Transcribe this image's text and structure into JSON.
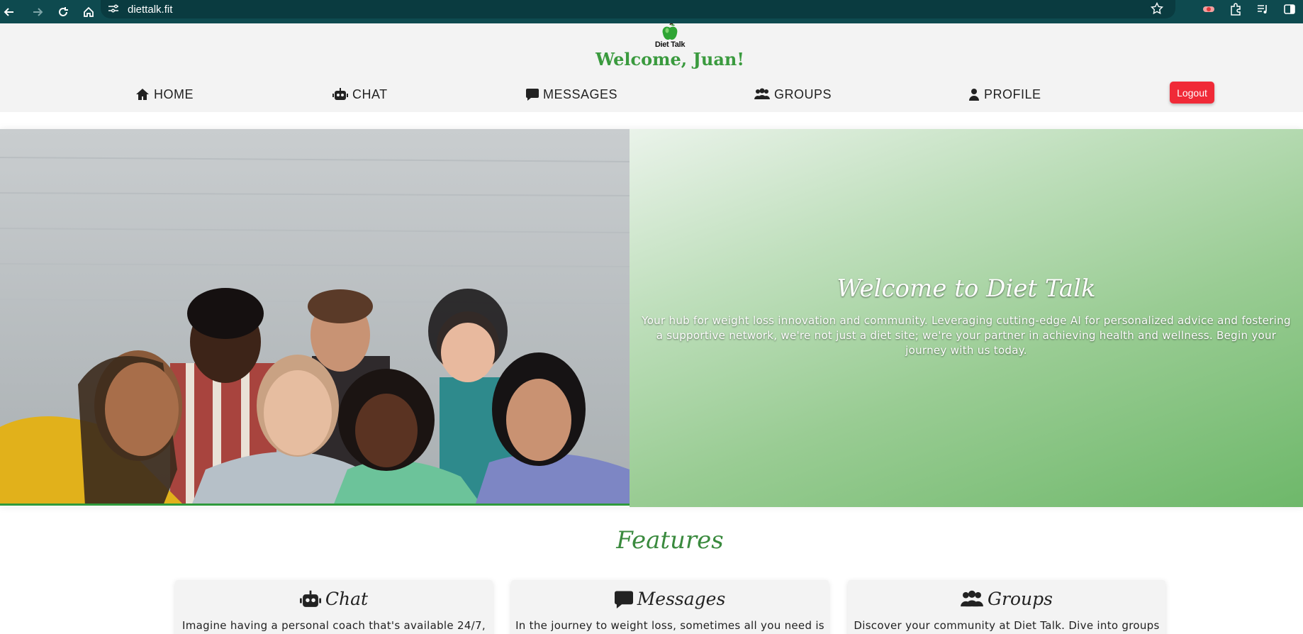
{
  "browser": {
    "url": "diettalk.fit"
  },
  "header": {
    "logo_text": "Diet Talk",
    "welcome": "Welcome, Juan!"
  },
  "nav": {
    "items": [
      {
        "label": "HOME",
        "icon": "home-icon"
      },
      {
        "label": "CHAT",
        "icon": "robot-icon"
      },
      {
        "label": "MESSAGES",
        "icon": "message-icon"
      },
      {
        "label": "GROUPS",
        "icon": "users-icon"
      },
      {
        "label": "PROFILE",
        "icon": "user-icon"
      }
    ],
    "logout_label": "Logout"
  },
  "hero": {
    "title": "Welcome to Diet Talk",
    "text": "Your hub for weight loss innovation and community. Leveraging cutting-edge AI for personalized advice and fostering a supportive network, we're not just a diet site; we're your partner in achieving health and wellness. Begin your journey with us today."
  },
  "features": {
    "title": "Features",
    "cards": [
      {
        "title": "Chat",
        "icon": "robot-icon",
        "text": "Imagine having a personal coach that's available 24/7,"
      },
      {
        "title": "Messages",
        "icon": "message-icon",
        "text": "In the journey to weight loss, sometimes all you need is"
      },
      {
        "title": "Groups",
        "icon": "users-icon",
        "text": "Discover your community at Diet Talk. Dive into groups"
      }
    ]
  },
  "colors": {
    "brand_green": "#3a9a3e",
    "logout_red": "#f02a37",
    "chrome_teal": "#0e4a4f"
  }
}
